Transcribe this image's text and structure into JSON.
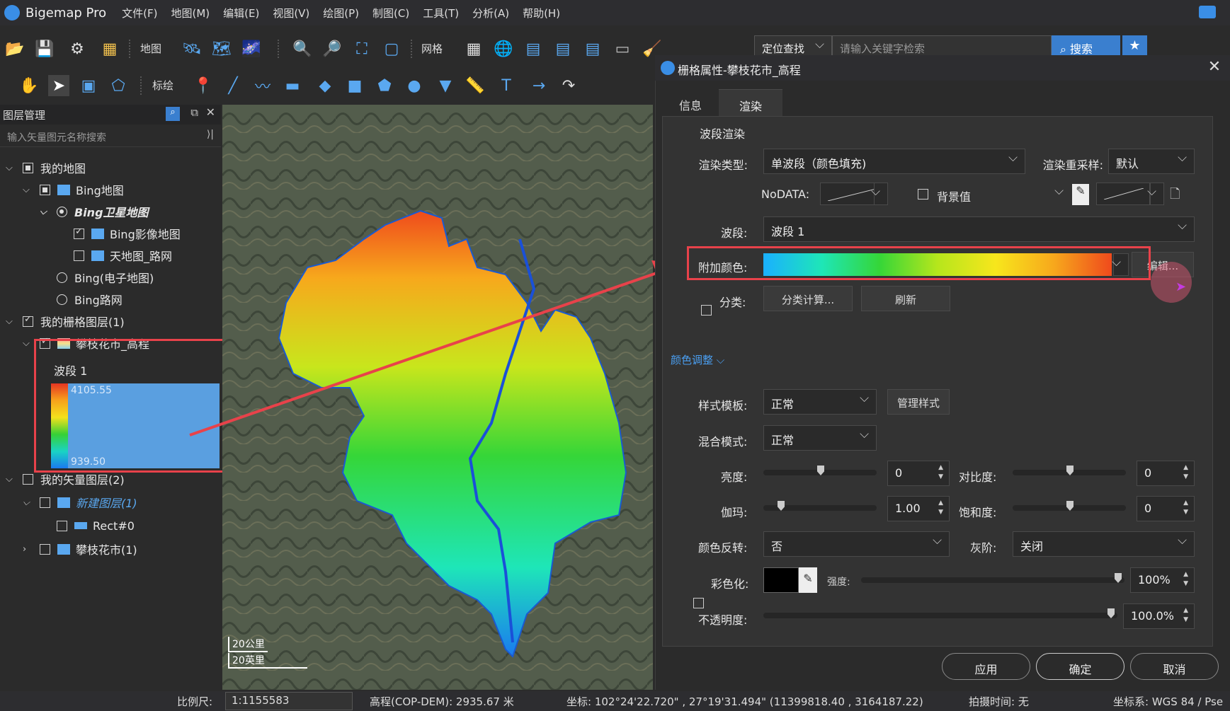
{
  "app": {
    "name": "Bigemap Pro"
  },
  "menu": [
    "文件(F)",
    "地图(M)",
    "编辑(E)",
    "视图(V)",
    "绘图(P)",
    "制图(C)",
    "工具(T)",
    "分析(A)",
    "帮助(H)"
  ],
  "toolbar": {
    "map_label": "地图",
    "grid_label": "网格",
    "annotate_label": "标绘",
    "search_mode": "定位查找",
    "search_placeholder": "请输入关键字检索",
    "search_button": "搜索"
  },
  "layer_panel": {
    "title": "图层管理",
    "search_placeholder": "输入矢量图元名称搜索",
    "tree": {
      "my_map": "我的地图",
      "bing_map": "Bing地图",
      "bing_satellite": "Bing卫星地图",
      "bing_image": "Bing影像地图",
      "tianditu_road": "天地图_路网",
      "bing_electronic": "Bing(电子地图)",
      "bing_road": "Bing路网",
      "raster_group": "我的栅格图层(1)",
      "raster_layer": "攀枝花市_高程",
      "band": "波段 1",
      "legend_max": "4105.55",
      "legend_min": "939.50",
      "vector_group": "我的矢量图层(2)",
      "new_layer": "新建图层(1)",
      "rect": "Rect#0",
      "panzhihua": "攀枝花市(1)"
    }
  },
  "map": {
    "scale_km": "20公里",
    "scale_mi": "20英里"
  },
  "dialog": {
    "title": "栅格属性-攀枝花市_高程",
    "tabs": [
      "信息",
      "渲染"
    ],
    "band_render_title": "波段渲染",
    "render_type_label": "渲染类型:",
    "render_type_value": "单波段（颜色填充)",
    "resample_label": "渲染重采样:",
    "resample_value": "默认",
    "nodata_label": "NoDATA:",
    "background_label": "背景值",
    "band_label": "波段:",
    "band_value": "波段 1",
    "color_label": "附加颜色:",
    "edit_button": "编辑...",
    "classify_label": "分类:",
    "classify_calc_button": "分类计算...",
    "refresh_button": "刷新",
    "color_adjust_title": "颜色调整",
    "style_template_label": "样式模板:",
    "style_template_value": "正常",
    "manage_style_button": "管理样式",
    "blend_mode_label": "混合模式:",
    "blend_mode_value": "正常",
    "brightness_label": "亮度:",
    "brightness_value": "0",
    "contrast_label": "对比度:",
    "contrast_value": "0",
    "gamma_label": "伽玛:",
    "gamma_value": "1.00",
    "saturation_label": "饱和度:",
    "saturation_value": "0",
    "invert_label": "颜色反转:",
    "invert_value": "否",
    "grayscale_label": "灰阶:",
    "grayscale_value": "关闭",
    "colorize_label": "彩色化:",
    "strength_label": "强度:",
    "strength_value": "100%",
    "opacity_label": "不透明度:",
    "opacity_value": "100.0%",
    "apply_button": "应用",
    "ok_button": "确定",
    "cancel_button": "取消"
  },
  "statusbar": {
    "scale_label": "比例尺:",
    "scale_value": "1:1155583",
    "elevation": "高程(COP-DEM): 2935.67 米",
    "coords": "坐标: 102°24'22.720\" , 27°19'31.494\"  (11399818.40 , 3164187.22)",
    "capture_time": "拍摄时间: 无",
    "crs": "坐标系: WGS 84 / Pse"
  }
}
